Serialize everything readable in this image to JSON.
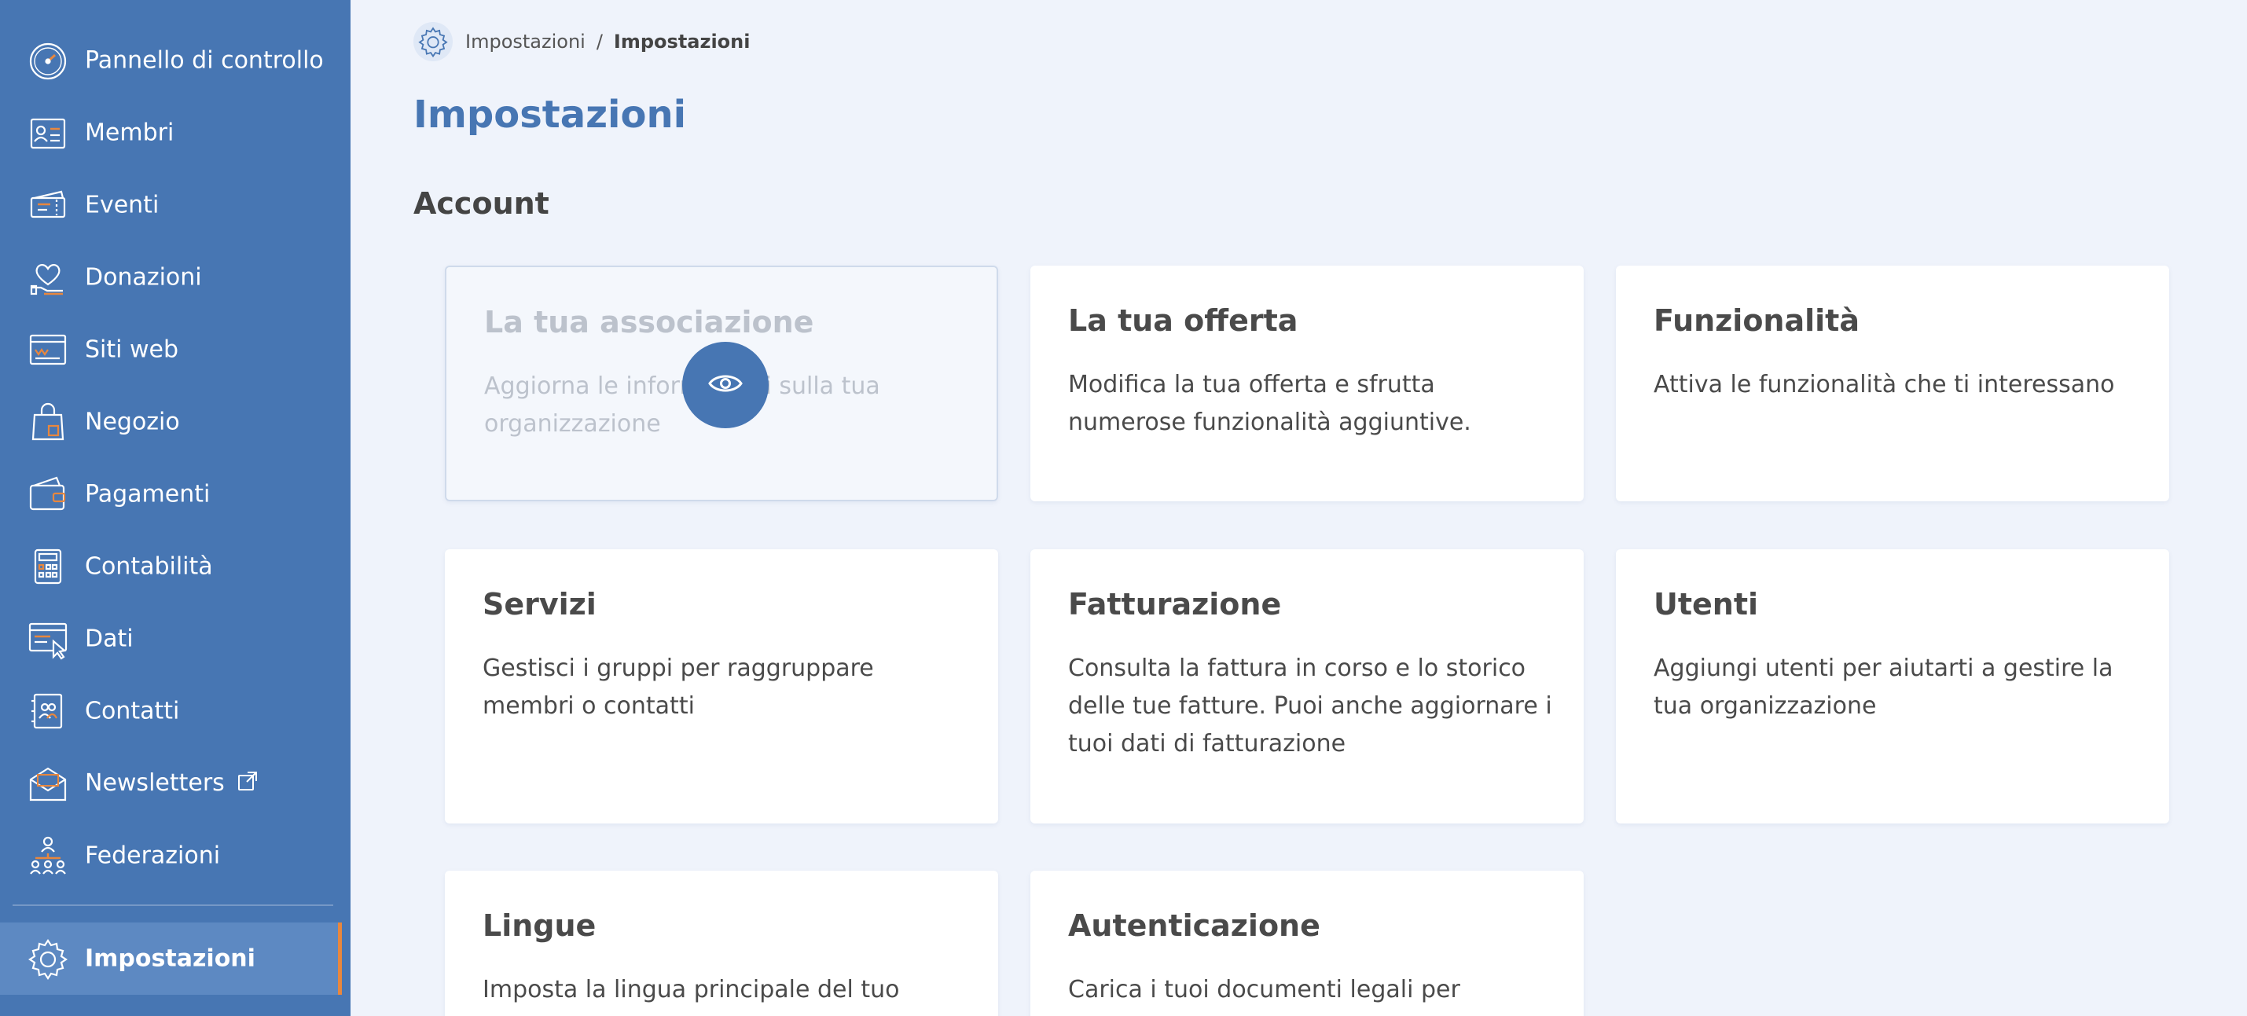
{
  "sidebar": {
    "items": [
      {
        "label": "Pannello di controllo",
        "icon": "dashboard-gauge-icon"
      },
      {
        "label": "Membri",
        "icon": "member-card-icon"
      },
      {
        "label": "Eventi",
        "icon": "ticket-icon"
      },
      {
        "label": "Donazioni",
        "icon": "heart-hand-icon"
      },
      {
        "label": "Siti web",
        "icon": "website-icon"
      },
      {
        "label": "Negozio",
        "icon": "shopping-bag-icon"
      },
      {
        "label": "Pagamenti",
        "icon": "wallet-icon"
      },
      {
        "label": "Contabilità",
        "icon": "calculator-icon"
      },
      {
        "label": "Dati",
        "icon": "data-screen-icon"
      },
      {
        "label": "Contatti",
        "icon": "contacts-icon"
      },
      {
        "label": "Newsletters",
        "icon": "envelope-icon",
        "external": "external-link-icon"
      },
      {
        "label": "Federazioni",
        "icon": "federation-icon"
      }
    ],
    "active": {
      "label": "Impostazioni",
      "icon": "gear-icon"
    }
  },
  "breadcrumb": {
    "icon": "gear-icon",
    "parent": "Impostazioni",
    "separator": "/",
    "current": "Impostazioni"
  },
  "page": {
    "title": "Impostazioni",
    "section": "Account"
  },
  "cards": [
    {
      "title": "La tua associazione",
      "desc": "Aggiorna le informazioni sulla tua organizzazione"
    },
    {
      "title": "La tua offerta",
      "desc": "Modifica la tua offerta e sfrutta numerose funzionalità aggiuntive."
    },
    {
      "title": "Funzionalità",
      "desc": "Attiva le funzionalità che ti interessano"
    },
    {
      "title": "Servizi",
      "desc": "Gestisci i gruppi per raggruppare membri o contatti"
    },
    {
      "title": "Fatturazione",
      "desc": "Consulta la fattura in corso e lo storico delle tue fatture. Puoi anche aggiornare i tuoi dati di fatturazione"
    },
    {
      "title": "Utenti",
      "desc": "Aggiungi utenti per aiutarti a gestire la tua organizzazione"
    },
    {
      "title": "Lingue",
      "desc": "Imposta la lingua principale del tuo"
    },
    {
      "title": "Autenticazione",
      "desc": "Carica i tuoi documenti legali per"
    }
  ],
  "overlay": {
    "icon": "eye-icon"
  },
  "colors": {
    "sidebar": "#4776b3",
    "sidebar_active": "#5d89c2",
    "accent_orange": "#e8873e",
    "title_blue": "#4776b3",
    "background": "#eff3fb"
  }
}
